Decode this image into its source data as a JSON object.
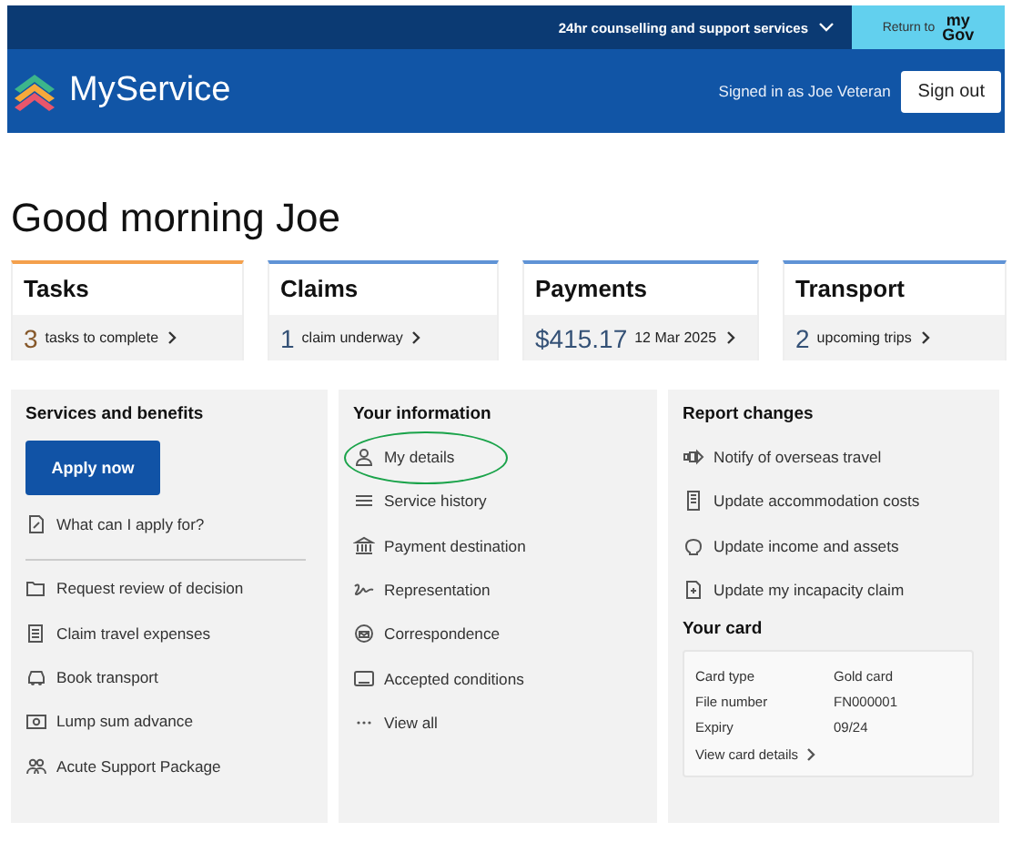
{
  "top_bar": {
    "support_link": "24hr counselling and support services",
    "return_button": {
      "label": "Return to",
      "brand_top": "my",
      "brand_bottom": "Gov"
    }
  },
  "header": {
    "app_name": "MyService",
    "signed_in": "Signed in as Joe Veteran",
    "sign_out": "Sign out"
  },
  "greeting": "Good morning Joe",
  "summary_cards": [
    {
      "title": "Tasks",
      "number": "3",
      "text": "tasks to complete",
      "color": "#f4a04c"
    },
    {
      "title": "Claims",
      "number": "1",
      "text": "claim underway",
      "color": "#5f93d6"
    },
    {
      "title": "Payments",
      "number": "$415.17",
      "text": "12 Mar 2025",
      "color": "#5f93d6"
    },
    {
      "title": "Transport",
      "number": "2",
      "text": "upcoming trips",
      "color": "#5f93d6"
    }
  ],
  "services": {
    "title": "Services and benefits",
    "apply_button": "Apply now",
    "intro_link": "What can I apply for?",
    "items": [
      "Request review of decision",
      "Claim travel expenses",
      "Book transport",
      "Lump sum advance",
      "Acute Support Package"
    ]
  },
  "your_information": {
    "title": "Your information",
    "items": [
      {
        "label": "My details",
        "circled": true
      },
      {
        "label": "Service history",
        "circled": false
      },
      {
        "label": "Payment destination",
        "circled": false
      },
      {
        "label": "Representation",
        "circled": false
      },
      {
        "label": "Correspondence",
        "circled": false
      },
      {
        "label": "Accepted conditions",
        "circled": false
      },
      {
        "label": "View all",
        "circled": false
      }
    ]
  },
  "report_changes": {
    "title": "Report changes",
    "items": [
      "Notify of overseas travel",
      "Update accommodation costs",
      "Update income and assets",
      "Update my incapacity claim"
    ]
  },
  "your_card": {
    "title": "Your card",
    "rows": [
      {
        "label": "Card type",
        "value": "Gold card"
      },
      {
        "label": "File number",
        "value": "FN000001"
      },
      {
        "label": "Expiry",
        "value": "09/24"
      }
    ],
    "link": "View card details"
  }
}
